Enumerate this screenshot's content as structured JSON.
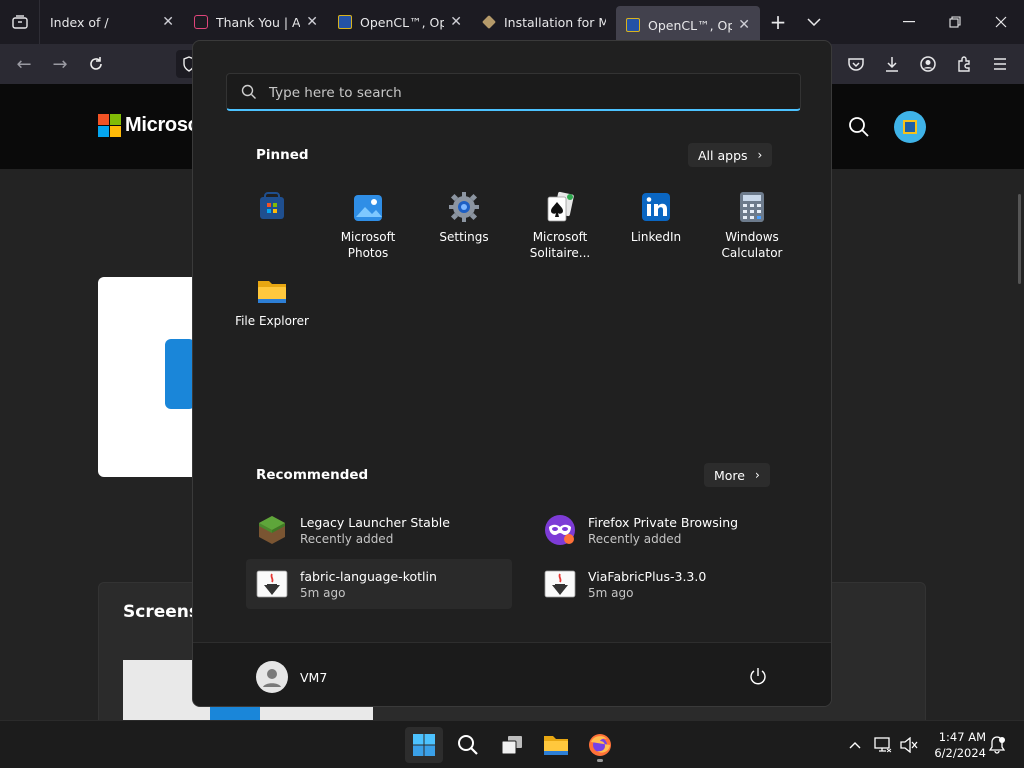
{
  "browser": {
    "tabs": [
      {
        "title": "Index of /",
        "active": false
      },
      {
        "title": "Thank You | Adobe",
        "active": false
      },
      {
        "title": "OpenCL™, OpenCL",
        "active": false
      },
      {
        "title": "Installation for Minecraft",
        "active": false
      },
      {
        "title": "OpenCL™, OpenCL",
        "active": true
      }
    ]
  },
  "website": {
    "logo_text": "Microsoft",
    "section_title": "Screenshots"
  },
  "start_menu": {
    "search_placeholder": "Type here to search",
    "pinned_title": "Pinned",
    "all_apps_label": "All apps",
    "pinned_apps": [
      {
        "name": "",
        "icon": "store-icon"
      },
      {
        "name": "Microsoft Photos",
        "icon": "photos-icon"
      },
      {
        "name": "Settings",
        "icon": "settings-gear-icon"
      },
      {
        "name": "Microsoft Solitaire...",
        "icon": "solitaire-icon"
      },
      {
        "name": "LinkedIn",
        "icon": "linkedin-icon"
      },
      {
        "name": "Windows Calculator",
        "icon": "calculator-icon"
      },
      {
        "name": "File Explorer",
        "icon": "folder-icon"
      }
    ],
    "recommended_title": "Recommended",
    "more_label": "More",
    "recommended": [
      {
        "title": "Legacy Launcher Stable",
        "subtitle": "Recently added",
        "icon": "minecraft-block-icon"
      },
      {
        "title": "Firefox Private Browsing",
        "subtitle": "Recently added",
        "icon": "private-browsing-mask-icon"
      },
      {
        "title": "fabric-language-kotlin",
        "subtitle": "5m ago",
        "icon": "java-file-icon"
      },
      {
        "title": "ViaFabricPlus-3.3.0",
        "subtitle": "5m ago",
        "icon": "java-file-icon"
      }
    ],
    "user_name": "VM7"
  },
  "taskbar": {
    "time": "1:47 AM",
    "date": "6/2/2024"
  },
  "colors": {
    "accent": "#4cc2ff",
    "start_bg": "#202020",
    "taskbar_bg": "#1c1c1c"
  }
}
